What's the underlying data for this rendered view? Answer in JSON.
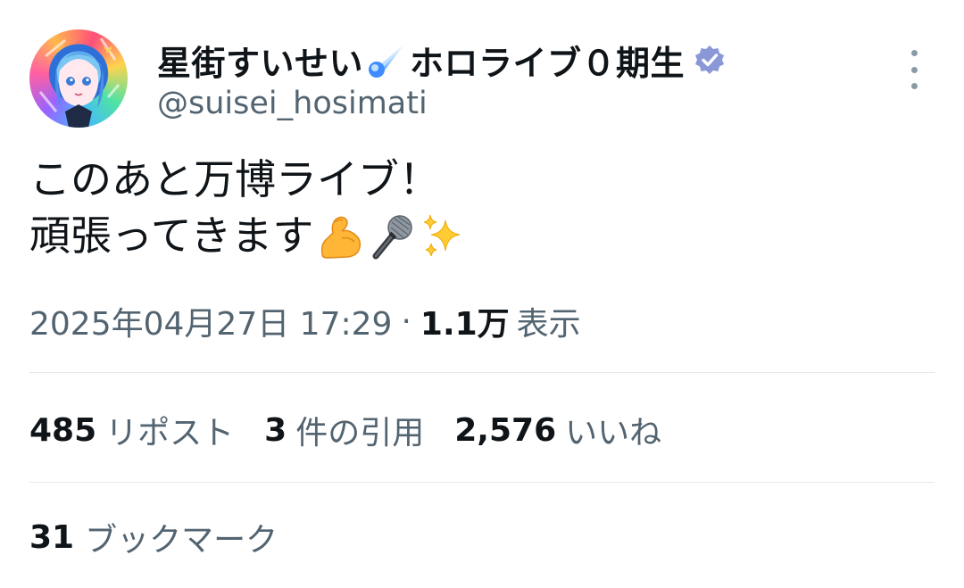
{
  "author": {
    "display_name": "星街すいせい",
    "display_name_suffix": "ホロライブ０期生",
    "handle": "@suisei_hosimati",
    "name_emoji": "comet-icon",
    "verified_icon": "verified-badge-icon",
    "avatar_icon": "avatar-image"
  },
  "tweet": {
    "line1": "このあと万博ライブ！",
    "line2": "頑張ってきます",
    "emojis": [
      "flexed-biceps-icon",
      "microphone-icon",
      "sparkles-icon"
    ]
  },
  "meta": {
    "datetime": "2025年04月27日 17:29",
    "separator": "·",
    "views_count": "1.1万",
    "views_label": "表示"
  },
  "stats": {
    "reposts_count": "485",
    "reposts_label": "リポスト",
    "quotes_count": "3",
    "quotes_label": "件の引用",
    "likes_count": "2,576",
    "likes_label": "いいね",
    "bookmarks_count": "31",
    "bookmarks_label": "ブックマーク"
  },
  "colors": {
    "primary_text": "#0f1419",
    "secondary_text": "#536471",
    "divider": "#e1e8ed",
    "verified_badge": "#8b98d8",
    "more_dots": "#8a9aa5"
  }
}
